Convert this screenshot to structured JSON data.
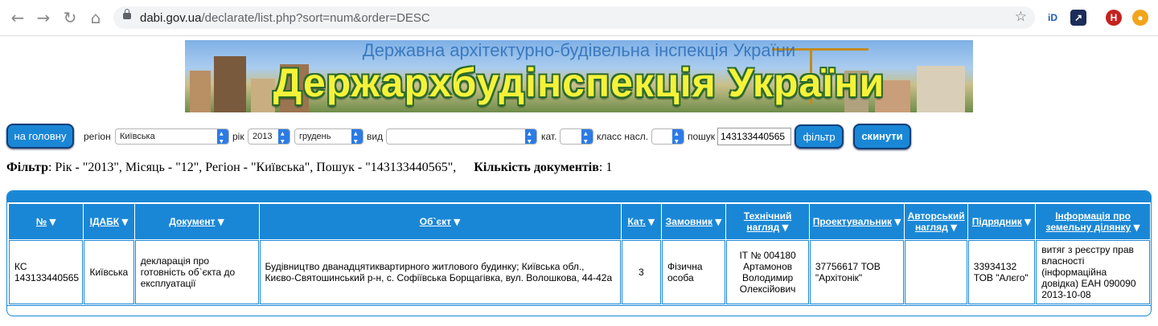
{
  "browser": {
    "url_domain": "dabi.gov.ua",
    "url_path": "/declarate/list.php?sort=num&order=DESC",
    "profile_initial": "H"
  },
  "banner": {
    "subtitle": "Державна архітектурно-будівельна інспекція України",
    "title": "Держархбудінспекція України"
  },
  "filters": {
    "home_button": "на головну",
    "region_label": "регіон",
    "region_value": "Київська",
    "year_label": "рік",
    "year_value": "2013",
    "month_value": "грудень",
    "type_label": "вид",
    "type_value": "",
    "cat_label": "кат.",
    "cat_value": "",
    "class_label": "класс насл.",
    "class_value": "",
    "search_label": "пошук",
    "search_value": "143133440565",
    "filter_button": "фільтр",
    "reset_button": "скинути"
  },
  "summary": {
    "filter_label": "Фільтр",
    "filter_text": ": Рік - \"2013\", Місяць - \"12\", Регіон - \"Київська\", Пошук - \"143133440565\",",
    "count_label": "Кількість документів",
    "count_value": ": 1"
  },
  "table": {
    "columns": [
      "№",
      "ІДАБК",
      "Документ",
      "Об`єкт",
      "Кат.",
      "Замовник",
      "Технічний нагляд",
      "Проектувальник",
      "Авторський нагляд",
      "Підрядник",
      "Інформація про земельну ділянку"
    ],
    "sort_glyph": "▼",
    "rows": [
      [
        "КС 143133440565",
        "Київська",
        "декларація про готовність об`єкта до експлуатації",
        "Будівництво дванадцятиквартирного житлового будинку; Київська обл., Києво-Святошинський р-н, с. Софіївська Борщагівка, вул. Волошкова, 44-42а",
        "3",
        "Фізична особа",
        "ІТ № 004180 Артамонов Володимир Олексійович",
        "37756617 ТОВ \"Архітонік\"",
        "",
        "33934132 ТОВ \"Алєго\"",
        "витяг з реєстру прав власності (інформаційна довідка) ЕАН 090090 2013-10-08"
      ]
    ]
  }
}
